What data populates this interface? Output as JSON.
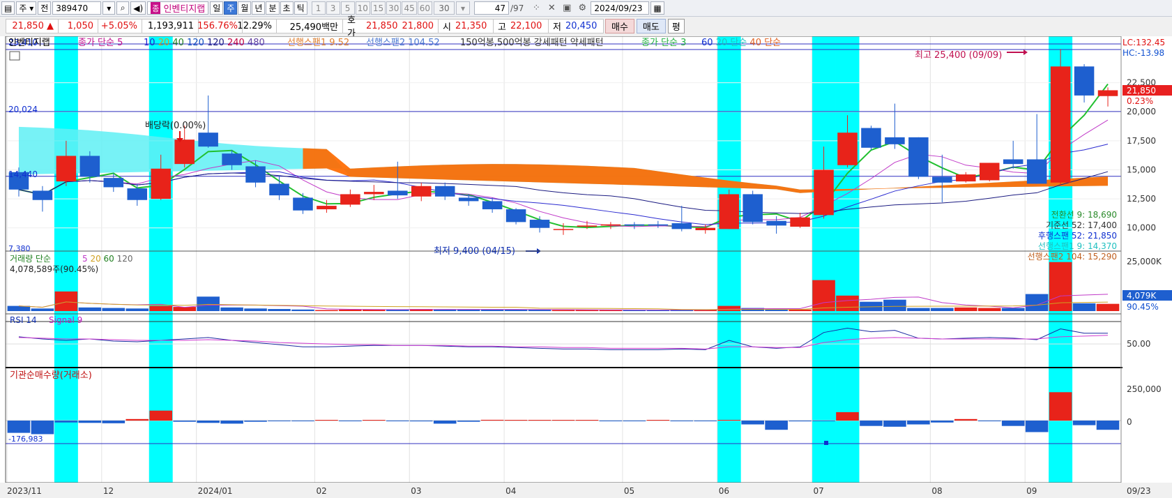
{
  "toolbar": {
    "period_unit": "주",
    "prev_label": "전",
    "code": "389470",
    "badge": "종",
    "stock_name": "인벤티지랩",
    "periods": [
      "일",
      "주",
      "월",
      "년",
      "분",
      "초",
      "틱"
    ],
    "selected_period": "주",
    "minute_steps": [
      "1",
      "3",
      "5",
      "10",
      "15",
      "30",
      "45",
      "60"
    ],
    "count_value": "30",
    "page_value": "47",
    "page_total": "/97",
    "date": "2024/09/23"
  },
  "quote": {
    "price": "21,850",
    "change": "1,050",
    "change_pct": "+5.05%",
    "volume": "1,193,911",
    "volume_ratio": "156.76%",
    "turnover": "12.29%",
    "amount": "25,490백만",
    "bid_label": "호가",
    "bid1": "21,850",
    "bid2": "21,800",
    "open_label": "시",
    "open": "21,350",
    "high_label": "고",
    "high": "22,100",
    "low_label": "저",
    "low": "20,450",
    "buy_label": "매수",
    "sell_label": "매도",
    "eval_label": "평"
  },
  "legend": {
    "name": "인벤티지랩",
    "hidden_prefix": "종가",
    "ma_label": "종가 단순 5",
    "ma_periods": [
      "10",
      "20",
      "40",
      "120",
      "120",
      "240",
      "480"
    ],
    "span1": "선행스팬1 9.52",
    "span2": "선행스팬2 104.52",
    "pattern": "150억봉,500억봉 강세패턴   약세패턴",
    "ma2_label": "종가 단순 3",
    "ma2_periods": [
      "60",
      "20 단순",
      "40 단순"
    ],
    "top_left_value": "23,410"
  },
  "annotations": {
    "max_label": "최고 25,400 (09/09)",
    "min_label": "최저 9,400 (04/15)",
    "dividend_label": "배당락(0.00%)",
    "level_20024": "20,024",
    "level_14440": "14,440",
    "level_7": "7,380",
    "lc": "LC:132.45",
    "hc": "HC:-13.98",
    "current_price": "21,850",
    "current_pct": "0.23%",
    "ichimoku": [
      "전환선 9: 18,690",
      "기준선 52: 17,400",
      "후행스팬 52: 21,850",
      "선행스팬1 9: 14,370",
      "선행스팬2 104: 15,290"
    ]
  },
  "price_axis": [
    "22,500",
    "20,000",
    "17,500",
    "15,000",
    "12,500",
    "10,000"
  ],
  "volume_panel": {
    "title": "거래량 단순",
    "periods": [
      "5",
      "20",
      "60",
      "120"
    ],
    "info": "4,078,589주(90.45%)",
    "axis": "25,000K",
    "current": "4,079K",
    "current_pct": "90.45%"
  },
  "rsi_panel": {
    "title": "RSI 14",
    "signal": "Signal 9",
    "axis": "50.00"
  },
  "inst_panel": {
    "title": "기관순매수량(거래소)",
    "axis_top": "250,000",
    "axis_zero": "0",
    "min_label": "-176,983"
  },
  "time_axis": [
    "2023/11",
    "12",
    "2024/01",
    "02",
    "03",
    "04",
    "05",
    "06",
    "07",
    "08",
    "09",
    "09/23"
  ],
  "colors": {
    "up": "#e8231a",
    "down": "#1e5fcf",
    "highlight": "#00ffff",
    "cloud": "#ff6a00"
  },
  "chart_data": {
    "type": "candlestick",
    "weeks": 47,
    "candles": [
      {
        "o": 14800,
        "c": 13300,
        "h": 15200,
        "l": 12700
      },
      {
        "o": 13200,
        "c": 12400,
        "h": 13600,
        "l": 11400
      },
      {
        "o": 14000,
        "c": 16200,
        "h": 17500,
        "l": 13600
      },
      {
        "o": 16200,
        "c": 14400,
        "h": 16600,
        "l": 13900
      },
      {
        "o": 14300,
        "c": 13500,
        "h": 14700,
        "l": 13100
      },
      {
        "o": 13400,
        "c": 12400,
        "h": 13800,
        "l": 11900
      },
      {
        "o": 12500,
        "c": 15100,
        "h": 16300,
        "l": 12400
      },
      {
        "o": 15500,
        "c": 17600,
        "h": 18800,
        "l": 15200
      },
      {
        "o": 18200,
        "c": 17000,
        "h": 21400,
        "l": 16900
      },
      {
        "o": 16400,
        "c": 15400,
        "h": 16700,
        "l": 15000
      },
      {
        "o": 15300,
        "c": 13900,
        "h": 15800,
        "l": 13500
      },
      {
        "o": 13800,
        "c": 12800,
        "h": 14500,
        "l": 12400
      },
      {
        "o": 12600,
        "c": 11500,
        "h": 13000,
        "l": 11200
      },
      {
        "o": 11600,
        "c": 11900,
        "h": 12400,
        "l": 11300
      },
      {
        "o": 12000,
        "c": 12900,
        "h": 13300,
        "l": 11800
      },
      {
        "o": 12900,
        "c": 13100,
        "h": 13700,
        "l": 12400
      },
      {
        "o": 13200,
        "c": 12800,
        "h": 15700,
        "l": 12500
      },
      {
        "o": 12700,
        "c": 13600,
        "h": 13900,
        "l": 12300
      },
      {
        "o": 13600,
        "c": 12700,
        "h": 13900,
        "l": 12400
      },
      {
        "o": 12600,
        "c": 12300,
        "h": 12900,
        "l": 11900
      },
      {
        "o": 12300,
        "c": 11600,
        "h": 12600,
        "l": 11300
      },
      {
        "o": 11600,
        "c": 10500,
        "h": 11700,
        "l": 10300
      },
      {
        "o": 10700,
        "c": 10000,
        "h": 11000,
        "l": 9600
      },
      {
        "o": 9900,
        "c": 9900,
        "h": 10400,
        "l": 9400
      },
      {
        "o": 10100,
        "c": 10200,
        "h": 10600,
        "l": 9900
      },
      {
        "o": 10200,
        "c": 10300,
        "h": 10500,
        "l": 9900
      },
      {
        "o": 10300,
        "c": 10200,
        "h": 10500,
        "l": 9900
      },
      {
        "o": 10300,
        "c": 10200,
        "h": 10600,
        "l": 10000
      },
      {
        "o": 10400,
        "c": 9900,
        "h": 11900,
        "l": 9700
      },
      {
        "o": 9800,
        "c": 10000,
        "h": 10300,
        "l": 9500
      },
      {
        "o": 9900,
        "c": 12900,
        "h": 13300,
        "l": 9900
      },
      {
        "o": 12900,
        "c": 10500,
        "h": 13200,
        "l": 10300
      },
      {
        "o": 10600,
        "c": 10200,
        "h": 11000,
        "l": 9500
      },
      {
        "o": 10100,
        "c": 10900,
        "h": 11300,
        "l": 10000
      },
      {
        "o": 11100,
        "c": 15000,
        "h": 17000,
        "l": 10800
      },
      {
        "o": 15400,
        "c": 18200,
        "h": 19700,
        "l": 15200
      },
      {
        "o": 18600,
        "c": 16900,
        "h": 18800,
        "l": 16700
      },
      {
        "o": 17800,
        "c": 17200,
        "h": 20700,
        "l": 16800
      },
      {
        "o": 17800,
        "c": 14400,
        "h": 17800,
        "l": 14200
      },
      {
        "o": 14400,
        "c": 13900,
        "h": 16300,
        "l": 12200
      },
      {
        "o": 14000,
        "c": 14600,
        "h": 14800,
        "l": 13900
      },
      {
        "o": 14100,
        "c": 15600,
        "h": 15600,
        "l": 14000
      },
      {
        "o": 15900,
        "c": 15500,
        "h": 17500,
        "l": 15100
      },
      {
        "o": 15900,
        "c": 13800,
        "h": 19800,
        "l": 13800
      },
      {
        "o": 13900,
        "c": 23900,
        "h": 25400,
        "l": 13700
      },
      {
        "o": 23900,
        "c": 21400,
        "h": 24100,
        "l": 20800
      },
      {
        "o": 21350,
        "c": 21850,
        "h": 22100,
        "l": 20450
      }
    ],
    "volume": [
      0.1,
      0.05,
      0.38,
      0.07,
      0.06,
      0.05,
      0.1,
      0.08,
      0.28,
      0.07,
      0.05,
      0.04,
      0.03,
      0.02,
      0.03,
      0.03,
      0.03,
      0.04,
      0.03,
      0.03,
      0.03,
      0.03,
      0.03,
      0.02,
      0.02,
      0.02,
      0.02,
      0.02,
      0.03,
      0.02,
      0.1,
      0.06,
      0.03,
      0.03,
      0.6,
      0.3,
      0.18,
      0.22,
      0.06,
      0.06,
      0.07,
      0.06,
      0.06,
      0.33,
      0.95,
      0.15,
      0.14
    ],
    "rsi": [
      60,
      57,
      55,
      57,
      54,
      53,
      55,
      57,
      59,
      55,
      52,
      49,
      46,
      46,
      47,
      48,
      48,
      48,
      47,
      46,
      46,
      45,
      44,
      43,
      43,
      42,
      42,
      42,
      43,
      42,
      55,
      46,
      44,
      46,
      66,
      72,
      67,
      69,
      58,
      57,
      58,
      59,
      58,
      56,
      71,
      65,
      65
    ],
    "rsi_signal": [
      59,
      58,
      57,
      57,
      56,
      55,
      55,
      55,
      56,
      55,
      54,
      52,
      51,
      50,
      49,
      49,
      48,
      48,
      48,
      47,
      47,
      46,
      46,
      45,
      45,
      44,
      44,
      44,
      44,
      43,
      46,
      46,
      45,
      45,
      52,
      56,
      58,
      59,
      58,
      57,
      57,
      57,
      57,
      57,
      60,
      61,
      62
    ],
    "institution": [
      -160000,
      -176983,
      -25000,
      -30000,
      -35000,
      20000,
      130000,
      -15000,
      -30000,
      -40000,
      -15000,
      -3000,
      -5000,
      5000,
      -5000,
      5000,
      -3000,
      -10000,
      -40000,
      -15000,
      10000,
      8000,
      5000,
      3000,
      2000,
      -3000,
      -2000,
      3000,
      -5000,
      -3000,
      5000,
      -50000,
      -120000,
      -10000,
      -5000,
      110000,
      -70000,
      -80000,
      -50000,
      -25000,
      20000,
      -5000,
      -70000,
      -150000,
      370000,
      -60000,
      -120000
    ],
    "highlight_weeks": [
      2,
      6,
      30,
      34,
      35,
      44
    ],
    "y_range": [
      8000,
      26500
    ]
  }
}
